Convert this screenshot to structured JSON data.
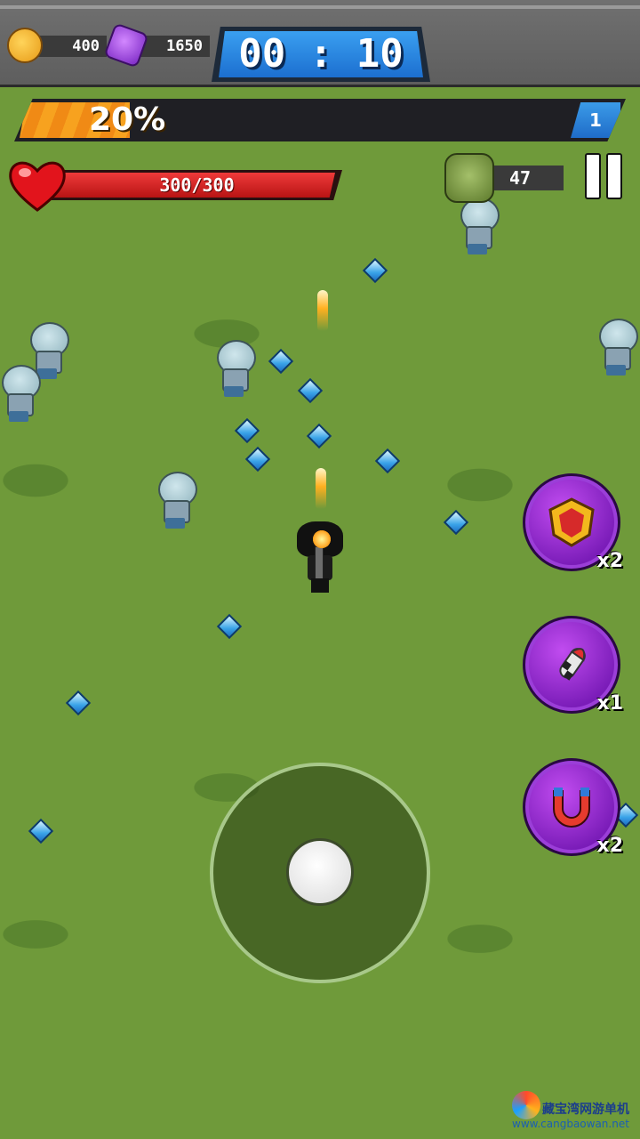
{
  "resources": {
    "coins": "400",
    "gems": "1650"
  },
  "timer": "00 : 10",
  "xp": {
    "percent_label": "20%",
    "progress": 0.2,
    "level": "1"
  },
  "health": {
    "label": "300/300",
    "current": 300,
    "max": 300
  },
  "kills": "47",
  "skills": [
    {
      "name": "shield",
      "count": "x2"
    },
    {
      "name": "rocket",
      "count": "x1"
    },
    {
      "name": "magnet",
      "count": "x2"
    }
  ],
  "watermark": {
    "cn": "藏宝湾网游单机",
    "url": "www.cangbaowan.net"
  },
  "colors": {
    "xp": "#f7a21f",
    "timer": "#2a86e0",
    "hp": "#d82424",
    "skill": "#9b2fd6",
    "grass": "#6f9a3a"
  }
}
